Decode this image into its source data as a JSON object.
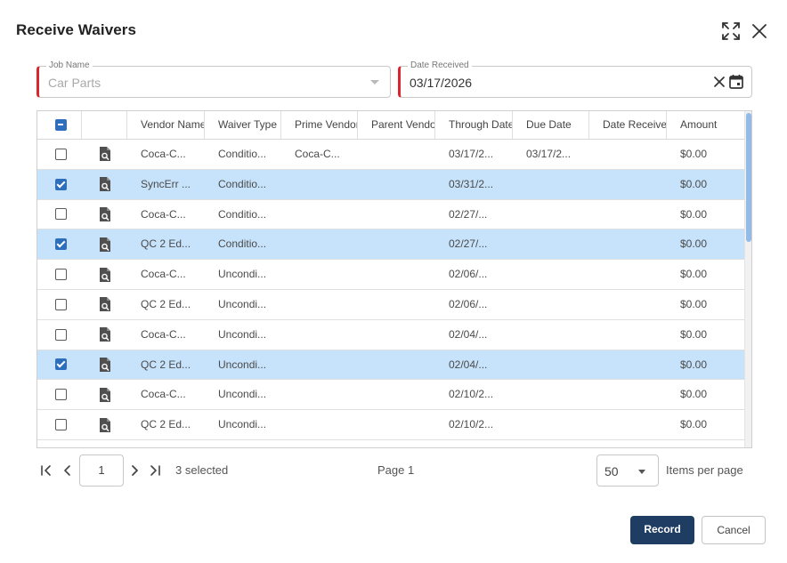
{
  "dialog": {
    "title": "Receive Waivers"
  },
  "icons": {
    "expand": "expand-icon",
    "close": "close-icon",
    "document": "document-search-icon",
    "calendar": "calendar-icon",
    "clear": "clear-icon"
  },
  "form": {
    "job_name_label": "Job Name",
    "job_name_value": "Car Parts",
    "date_received_label": "Date Received",
    "date_received_value": "03/17/2026"
  },
  "table": {
    "columns": [
      "Vendor Name",
      "Waiver Type",
      "Prime Vendor",
      "Parent Vendor",
      "Through Date",
      "Due Date",
      "Date Received",
      "Amount"
    ],
    "rows": [
      {
        "selected": false,
        "vendor": "Coca-C...",
        "waiver_type": "Conditio...",
        "prime_vendor": "Coca-C...",
        "parent_vendor": "",
        "through_date": "03/17/2...",
        "due_date": "03/17/2...",
        "date_received": "",
        "amount": "$0.00"
      },
      {
        "selected": true,
        "vendor": "SyncErr ...",
        "waiver_type": "Conditio...",
        "prime_vendor": "",
        "parent_vendor": "",
        "through_date": "03/31/2...",
        "due_date": "",
        "date_received": "",
        "amount": "$0.00"
      },
      {
        "selected": false,
        "vendor": "Coca-C...",
        "waiver_type": "Conditio...",
        "prime_vendor": "",
        "parent_vendor": "",
        "through_date": "02/27/...",
        "due_date": "",
        "date_received": "",
        "amount": "$0.00"
      },
      {
        "selected": true,
        "vendor": "QC 2 Ed...",
        "waiver_type": "Conditio...",
        "prime_vendor": "",
        "parent_vendor": "",
        "through_date": "02/27/...",
        "due_date": "",
        "date_received": "",
        "amount": "$0.00"
      },
      {
        "selected": false,
        "vendor": "Coca-C...",
        "waiver_type": "Uncondi...",
        "prime_vendor": "",
        "parent_vendor": "",
        "through_date": "02/06/...",
        "due_date": "",
        "date_received": "",
        "amount": "$0.00"
      },
      {
        "selected": false,
        "vendor": "QC 2 Ed...",
        "waiver_type": "Uncondi...",
        "prime_vendor": "",
        "parent_vendor": "",
        "through_date": "02/06/...",
        "due_date": "",
        "date_received": "",
        "amount": "$0.00"
      },
      {
        "selected": false,
        "vendor": "Coca-C...",
        "waiver_type": "Uncondi...",
        "prime_vendor": "",
        "parent_vendor": "",
        "through_date": "02/04/...",
        "due_date": "",
        "date_received": "",
        "amount": "$0.00"
      },
      {
        "selected": true,
        "vendor": "QC 2 Ed...",
        "waiver_type": "Uncondi...",
        "prime_vendor": "",
        "parent_vendor": "",
        "through_date": "02/04/...",
        "due_date": "",
        "date_received": "",
        "amount": "$0.00"
      },
      {
        "selected": false,
        "vendor": "Coca-C...",
        "waiver_type": "Uncondi...",
        "prime_vendor": "",
        "parent_vendor": "",
        "through_date": "02/10/2...",
        "due_date": "",
        "date_received": "",
        "amount": "$0.00"
      },
      {
        "selected": false,
        "vendor": "QC 2 Ed...",
        "waiver_type": "Uncondi...",
        "prime_vendor": "",
        "parent_vendor": "",
        "through_date": "02/10/2...",
        "due_date": "",
        "date_received": "",
        "amount": "$0.00"
      }
    ]
  },
  "pager": {
    "current_page": "1",
    "selected_text": "3 selected",
    "page_text": "Page 1",
    "per_page_value": "50",
    "per_page_label": "Items per page"
  },
  "actions": {
    "record_label": "Record",
    "cancel_label": "Cancel"
  },
  "colors": {
    "accent": "#2e6fbd",
    "selected_row": "#c7e3fb",
    "required_marker": "#d9262c",
    "primary_button": "#1f3d63"
  }
}
